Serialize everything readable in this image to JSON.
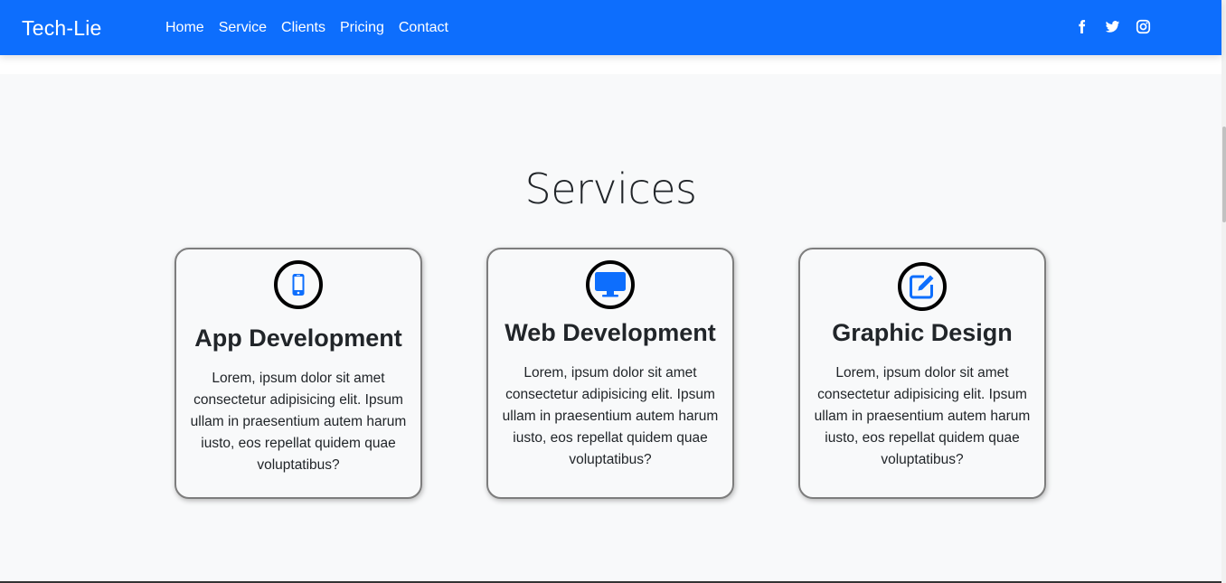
{
  "navbar": {
    "brand": "Tech-Lie",
    "links": [
      {
        "label": "Home"
      },
      {
        "label": "Service"
      },
      {
        "label": "Clients"
      },
      {
        "label": "Pricing"
      },
      {
        "label": "Contact"
      }
    ],
    "social_icons": [
      "facebook-icon",
      "twitter-icon",
      "instagram-icon"
    ],
    "background_color": "#0d6efd"
  },
  "services": {
    "title": "Services",
    "cards": [
      {
        "icon": "mobile-phone-icon",
        "title": "App Development",
        "text": "Lorem, ipsum dolor sit amet consectetur adipisicing elit. Ipsum ullam in praesentium autem harum iusto, eos repellat quidem quae voluptatibus?"
      },
      {
        "icon": "desktop-monitor-icon",
        "title": "Web Development",
        "text": "Lorem, ipsum dolor sit amet consectetur adipisicing elit. Ipsum ullam in praesentium autem harum iusto, eos repellat quidem quae voluptatibus?"
      },
      {
        "icon": "pencil-square-icon",
        "title": "Graphic Design",
        "text": "Lorem, ipsum dolor sit amet consectetur adipisicing elit. Ipsum ullam in praesentium autem harum iusto, eos repellat quidem quae voluptatibus?"
      }
    ],
    "icon_color": "#0d6efd"
  }
}
